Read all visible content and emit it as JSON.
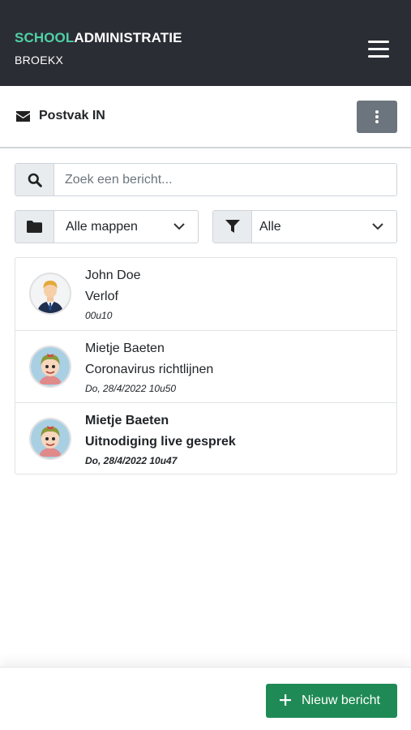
{
  "header": {
    "brand_accent": "SCHOOL",
    "brand_rest": "ADMINISTRATIE",
    "school": "BROEKX",
    "menu_icon": "hamburger-icon",
    "accent_color": "#4fd1a5",
    "background_color": "#2b2d35"
  },
  "subheader": {
    "icon": "envelope-icon",
    "title": "Postvak IN",
    "options_icon": "vertical-dots-icon"
  },
  "search": {
    "icon": "search-icon",
    "placeholder": "Zoek een bericht...",
    "value": ""
  },
  "filters": {
    "folder": {
      "icon": "folder-icon",
      "selected": "Alle mappen"
    },
    "status": {
      "icon": "filter-icon",
      "selected": "Alle"
    }
  },
  "messages": [
    {
      "sender": "John Doe",
      "subject": "Verlof",
      "time": "00u10",
      "unread": false,
      "avatar": "man-avatar"
    },
    {
      "sender": "Mietje Baeten",
      "subject": "Coronavirus richtlijnen",
      "time": "Do, 28/4/2022 10u50",
      "unread": false,
      "avatar": "girl-avatar"
    },
    {
      "sender": "Mietje Baeten",
      "subject": "Uitnodiging live gesprek",
      "time": "Do, 28/4/2022 10u47",
      "unread": true,
      "avatar": "girl-avatar"
    }
  ],
  "footer": {
    "new_message_label": "Nieuw bericht",
    "new_message_icon": "plus-icon",
    "button_color": "#1f8a55"
  }
}
